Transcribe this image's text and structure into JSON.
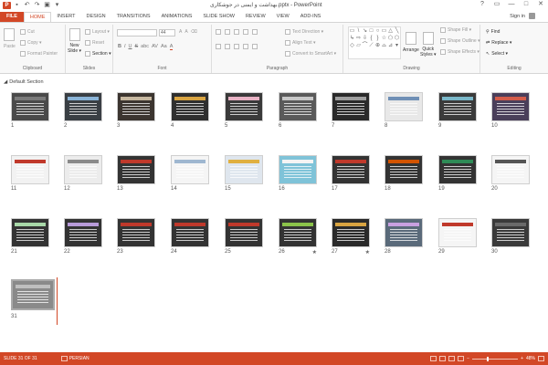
{
  "window": {
    "title": "بهداشت و ایمنی در جوشکاری.pptx - PowerPoint",
    "controls": [
      "?",
      "▭",
      "—",
      "□",
      "✕"
    ]
  },
  "qat": {
    "logo": "P",
    "undo": "↶",
    "redo": "↷",
    "customize": "▾"
  },
  "tabs": [
    "FILE",
    "HOME",
    "INSERT",
    "DESIGN",
    "TRANSITIONS",
    "ANIMATIONS",
    "SLIDE SHOW",
    "REVIEW",
    "VIEW",
    "ADD-INS"
  ],
  "active_tab": "HOME",
  "signin": "Sign in",
  "ribbon": {
    "clipboard": {
      "label": "Clipboard",
      "paste": "Paste",
      "cut": "Cut",
      "copy": "Copy ▾",
      "format_painter": "Format Painter"
    },
    "slides": {
      "label": "Slides",
      "new_slide": "New",
      "new_slide2": "Slide ▾",
      "layout": "Layout ▾",
      "reset": "Reset",
      "section": "Section ▾"
    },
    "font": {
      "label": "Font",
      "size_value": "44",
      "grow": "A",
      "shrink": "A",
      "bold": "B",
      "italic": "I",
      "underline": "U",
      "strike": "S",
      "shadow": "abc",
      "spacing": "AV",
      "case": "Aa",
      "color": "A"
    },
    "paragraph": {
      "label": "Paragraph",
      "text_direction": "Text Direction ▾",
      "align_text": "Align Text ▾",
      "smartart": "Convert to SmartArt ▾"
    },
    "drawing": {
      "label": "Drawing",
      "arrange": "Arrange",
      "quick_styles": "Quick",
      "quick_styles2": "Styles ▾",
      "shape_fill": "Shape Fill ▾",
      "shape_outline": "Shape Outline ▾",
      "shape_effects": "Shape Effects ▾",
      "shapes": [
        "▭",
        "\\",
        "↘",
        "□",
        "○",
        "▭",
        "△",
        "╲",
        "↳",
        "⇨",
        "⇩",
        "{",
        "}",
        "☆",
        "⬠",
        "⬡",
        "◇",
        "▱",
        "⌒",
        "⟋",
        "⊕",
        "⌓",
        "⊿",
        "▾"
      ]
    },
    "editing": {
      "label": "Editing",
      "find": "Find",
      "replace": "Replace ▾",
      "select": "Select ▾"
    }
  },
  "section": {
    "toggle": "◢",
    "name": "Default Section"
  },
  "slides": [
    {
      "n": "1",
      "bg": "#4a4a4a",
      "bar": "#7a7a7a"
    },
    {
      "n": "2",
      "bg": "#3a3f44",
      "bar": "#8ab4d8"
    },
    {
      "n": "3",
      "bg": "#3c3530",
      "bar": "#c7b8a0"
    },
    {
      "n": "4",
      "bg": "#2f2f2f",
      "bar": "#d9a441"
    },
    {
      "n": "5",
      "bg": "#3a3a3a",
      "bar": "#e8b2c4"
    },
    {
      "n": "6",
      "bg": "#5a5a5a",
      "bar": "#c8c8c8"
    },
    {
      "n": "7",
      "bg": "#2a2a2a",
      "bar": "#9e9e9e"
    },
    {
      "n": "8",
      "bg": "#e8e8e8",
      "bar": "#6f8fb5"
    },
    {
      "n": "9",
      "bg": "#3b3b3b",
      "bar": "#7ab8c9"
    },
    {
      "n": "10",
      "bg": "#4a3f5a",
      "bar": "#d45c4a"
    },
    {
      "n": "11",
      "bg": "#f2f2f2",
      "bar": "#c0392b"
    },
    {
      "n": "12",
      "bg": "#ececec",
      "bar": "#8a8a8a"
    },
    {
      "n": "13",
      "bg": "#333333",
      "bar": "#c0392b"
    },
    {
      "n": "14",
      "bg": "#f5f5f5",
      "bar": "#9fb7d0"
    },
    {
      "n": "15",
      "bg": "#dfe6ee",
      "bar": "#e0b040"
    },
    {
      "n": "16",
      "bg": "#7fc3d8",
      "bar": "#f4f4f4"
    },
    {
      "n": "17",
      "bg": "#333333",
      "bar": "#c0392b"
    },
    {
      "n": "18",
      "bg": "#333333",
      "bar": "#d35400"
    },
    {
      "n": "19",
      "bg": "#333333",
      "bar": "#2e8b57"
    },
    {
      "n": "20",
      "bg": "#f5f5f5",
      "bar": "#555555"
    },
    {
      "n": "21",
      "bg": "#333333",
      "bar": "#a8d8a8"
    },
    {
      "n": "22",
      "bg": "#333333",
      "bar": "#b89bd9"
    },
    {
      "n": "23",
      "bg": "#333333",
      "bar": "#c0392b"
    },
    {
      "n": "24",
      "bg": "#333333",
      "bar": "#c0392b"
    },
    {
      "n": "25",
      "bg": "#333333",
      "bar": "#c0392b"
    },
    {
      "n": "26",
      "bg": "#333333",
      "bar": "#8bc34a",
      "star": "★"
    },
    {
      "n": "27",
      "bg": "#2a2a2a",
      "bar": "#d9a441",
      "star": "★"
    },
    {
      "n": "28",
      "bg": "#5a6a7a",
      "bar": "#c9a0e0"
    },
    {
      "n": "29",
      "bg": "#f5f5f5",
      "bar": "#c0392b"
    },
    {
      "n": "30",
      "bg": "#3a3a3a",
      "bar": "#6a6a6a"
    },
    {
      "n": "31",
      "bg": "#8a8a8a",
      "bar": "#bfbfbf"
    }
  ],
  "status": {
    "slide_indicator": "SLIDE 31 OF 31",
    "language": "PERSIAN",
    "zoom_minus": "−",
    "zoom_plus": "+",
    "zoom": "48%"
  },
  "colors": {
    "accent": "#d24726"
  }
}
